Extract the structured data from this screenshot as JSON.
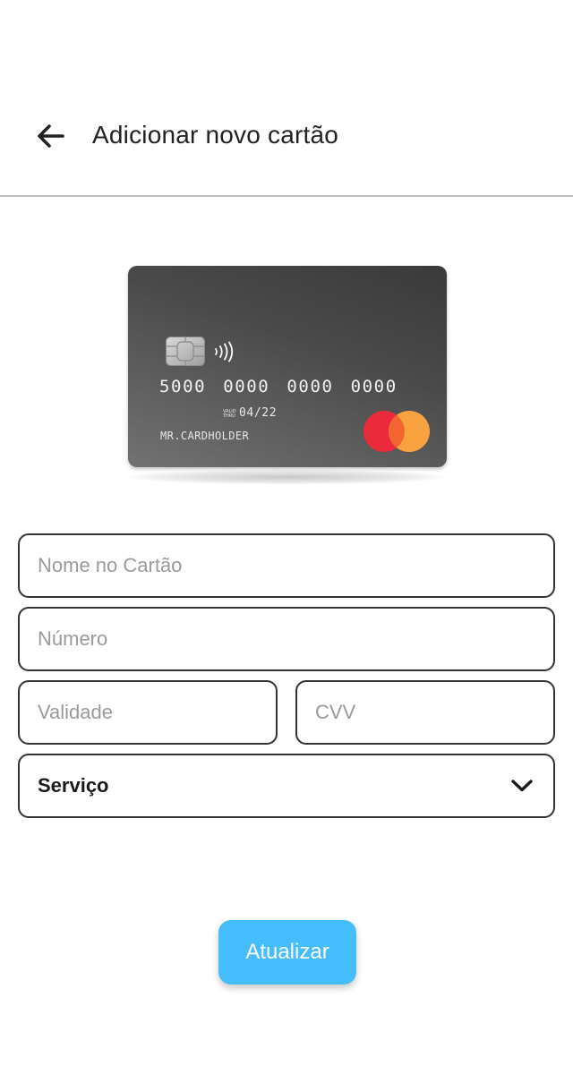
{
  "header": {
    "title": "Adicionar novo cartão",
    "back_icon": "arrow-left-icon"
  },
  "card": {
    "number": "5000 0000 0000 0000",
    "valid_thru_label": "VALID THRU",
    "expiry": "04/22",
    "holder": "MR.CARDHOLDER",
    "brand": "mastercard",
    "colors": {
      "mc_red": "#eb2a3b",
      "mc_orange": "#f9a340",
      "mc_overlap": "#f2652e"
    }
  },
  "form": {
    "name_placeholder": "Nome no Cartão",
    "name_value": "",
    "number_placeholder": "Número",
    "number_value": "",
    "validity_placeholder": "Validade",
    "validity_value": "",
    "cvv_placeholder": "CVV",
    "cvv_value": "",
    "service": {
      "selected": "Serviço",
      "icon": "chevron-down-icon"
    }
  },
  "actions": {
    "update_label": "Atualizar",
    "update_color": "#45bdfc"
  }
}
